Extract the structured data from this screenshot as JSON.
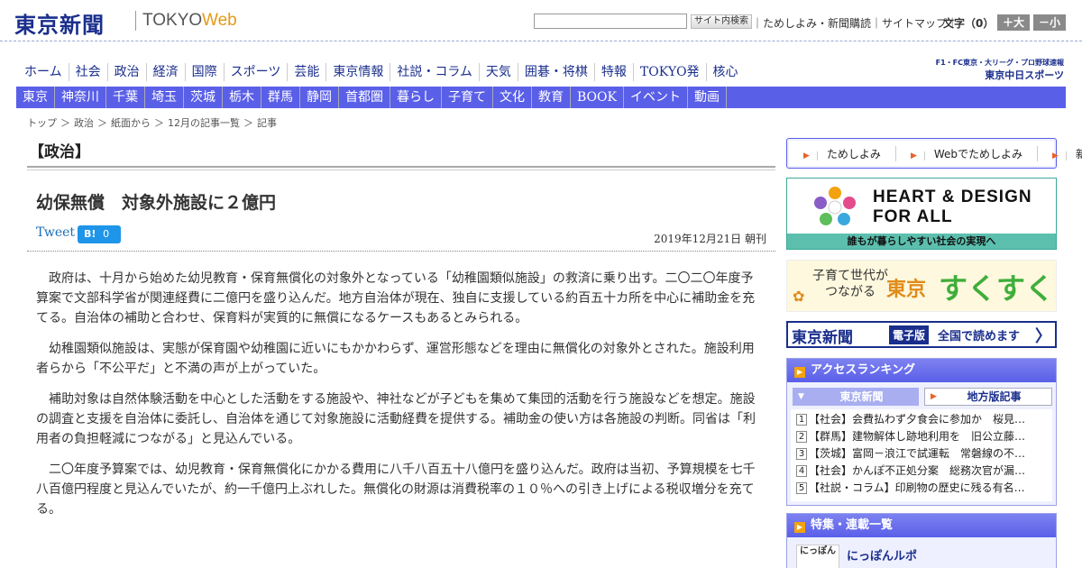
{
  "header": {
    "logo": "東京新聞",
    "logo_tokyo": "TOKYO",
    "logo_web": "Web",
    "search_placeholder": "",
    "search_button": "サイト内検索",
    "link_trial": "ためしよみ・新聞購読",
    "link_sitemap": "サイトマップ",
    "fontsize_label": "文字（0）",
    "fontsize_up": "＋大",
    "fontsize_down": "－小"
  },
  "topnav": [
    "ホーム",
    "社会",
    "政治",
    "経済",
    "国際",
    "スポーツ",
    "芸能",
    "東京情報",
    "社説・コラム",
    "天気",
    "囲碁・将棋",
    "特報",
    "TOKYO発",
    "核心"
  ],
  "chunichi": {
    "line1": "F1・FC東京・大リーグ・プロ野球速報",
    "line2": "東京中日スポーツ"
  },
  "regnav": [
    "東京",
    "神奈川",
    "千葉",
    "埼玉",
    "茨城",
    "栃木",
    "群馬",
    "静岡",
    "首都圏",
    "暮らし",
    "子育て",
    "文化",
    "教育",
    "BOOK",
    "イベント",
    "動画"
  ],
  "breadcrumb": [
    "トップ",
    "＞",
    "政治",
    "＞",
    "紙面から",
    "＞",
    "12月の記事一覧",
    "＞",
    "記事"
  ],
  "section_title": "【政治】",
  "article": {
    "title": "幼保無償　対象外施設に２億円",
    "tweet": "Tweet",
    "hatena_label": "B!",
    "hatena_count": "0",
    "date": "2019年12月21日 朝刊",
    "paragraphs": [
      "政府は、十月から始めた幼児教育・保育無償化の対象外となっている「幼稚園類似施設」の救済に乗り出す。二〇二〇年度予算案で文部科学省が関連経費に二億円を盛り込んだ。地方自治体が現在、独自に支援している約百五十カ所を中心に補助金を充てる。自治体の補助と合わせ、保育料が実質的に無償になるケースもあるとみられる。",
      "幼稚園類似施設は、実態が保育園や幼稚園に近いにもかかわらず、運営形態などを理由に無償化の対象外とされた。施設利用者らから「不公平だ」と不満の声が上がっていた。",
      "補助対象は自然体験活動を中心とした活動をする施設や、神社などが子どもを集めて集団的活動を行う施設などを想定。施設の調査と支援を自治体に委託し、自治体を通じて対象施設に活動経費を提供する。補助金の使い方は各施設の判断。同省は「利用者の負担軽減につながる」と見込んでいる。",
      "二〇年度予算案では、幼児教育・保育無償化にかかる費用に八千八百五十八億円を盛り込んだ。政府は当初、予算規模を七千八百億円程度と見込んでいたが、約一千億円上ぶれした。無償化の財源は消費税率の１０％への引き上げによる税収増分を充てる。"
    ]
  },
  "side": {
    "tameshi": [
      "ためしよみ",
      "Webでためしよみ",
      "新聞購読"
    ],
    "heart_title1": "HEART & DESIGN",
    "heart_title2": "FOR ALL",
    "heart_sub": "誰もが暮らしやすい社会の実現へ",
    "suku_small1": "子育て世代が",
    "suku_small2": "つながる",
    "suku_tokyo": "東京",
    "suku_big": "すくすく",
    "denshi_logo": "東京新聞",
    "denshi_badge": "電子版",
    "denshi_text": "全国で読めます",
    "denshi_arrow": "〉",
    "ranking_title": "アクセスランキング",
    "ranking_tab1": "東京新聞",
    "ranking_tab2": "地方版記事",
    "ranking": [
      {
        "num": "1",
        "text": "【社会】会費払わず夕食会に参加か　桜見…"
      },
      {
        "num": "2",
        "text": "【群馬】建物解体し跡地利用を　旧公立藤…"
      },
      {
        "num": "3",
        "text": "【茨城】富岡－浪江で試運転　常磐線の不…"
      },
      {
        "num": "4",
        "text": "【社会】かんぽ不正処分案　総務次官が漏…"
      },
      {
        "num": "5",
        "text": "【社説・コラム】印刷物の歴史に残る有名…"
      }
    ],
    "features_title": "特集・連載一覧",
    "nippon_box": "にっぽん",
    "nippon_title": "にっぽんルポ"
  }
}
